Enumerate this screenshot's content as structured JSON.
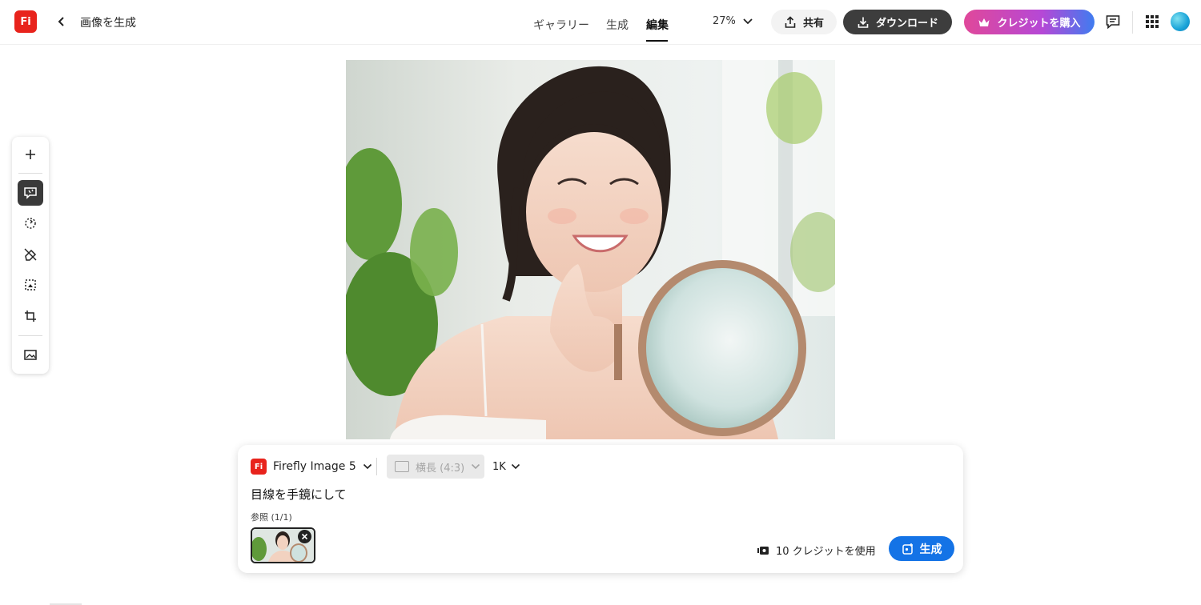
{
  "app": {
    "logo_text": "Fi"
  },
  "header": {
    "title": "画像を生成",
    "tabs": [
      {
        "label": "ギャラリー"
      },
      {
        "label": "生成"
      },
      {
        "label": "編集",
        "active": true
      }
    ],
    "zoom": "27%",
    "share_label": "共有",
    "download_label": "ダウンロード",
    "buy_credits_label": "クレジットを購入"
  },
  "toolbar": {
    "tools": [
      {
        "icon": "plus-icon"
      },
      {
        "icon": "prompt-edit-icon",
        "active": true
      },
      {
        "icon": "remove-background-icon"
      },
      {
        "icon": "eraser-icon"
      },
      {
        "icon": "expand-image-icon"
      },
      {
        "icon": "crop-icon"
      },
      {
        "icon": "image-upload-icon"
      }
    ]
  },
  "prompt_panel": {
    "model_logo_text": "Fi",
    "model": "Firefly Image 5",
    "aspect_ratio": "横長 (4:3)",
    "resolution": "1K",
    "prompt": "目線を手鏡にして",
    "reference_label": "参照 (1/1)",
    "cost": "10 クレジットを使用",
    "generate_label": "生成"
  },
  "colors": {
    "brand_red": "#e8231c",
    "primary_blue": "#1473e6",
    "dark_button": "#3d3d3d"
  }
}
